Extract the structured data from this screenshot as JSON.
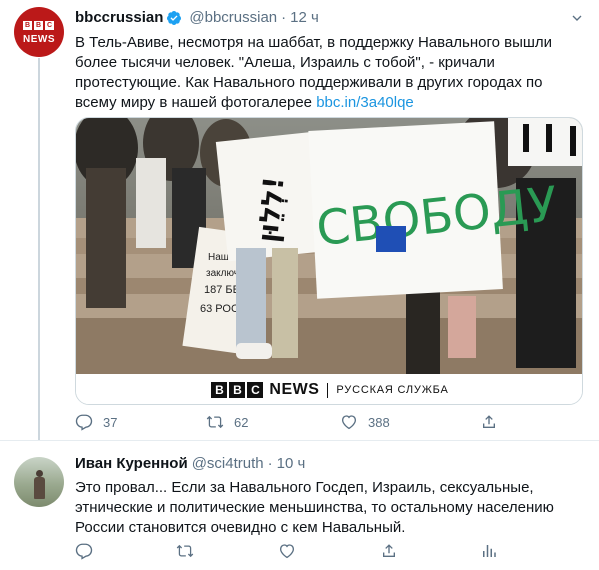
{
  "tweets": [
    {
      "author": {
        "name": "bbccrussian",
        "handle": "@bbcrussian",
        "verified": true,
        "time": "12 ч"
      },
      "avatar": {
        "blocks": [
          "B",
          "B",
          "C"
        ],
        "label": "NEWS"
      },
      "text": "В Тель-Авиве, несмотря на шаббат, в поддержку Навального вышли более тысячи человек. \"Алеша, Израиль с тобой\", - кричали протестующие. Как Навального поддерживали в других городах по всему миру в нашей фотогалерее ",
      "link": "bbc.in/3a40lqe",
      "media": {
        "caption_blocks": [
          "B",
          "B",
          "C"
        ],
        "caption_news": "NEWS",
        "caption_service": "РУССКАЯ СЛУЖБА",
        "sign_text": "СВОБОДУ",
        "left_sign_text": "לְלֵוּן!",
        "small_sign_lines": [
          "Наши",
          "заключе",
          "187 БЕЛ",
          "63 РОСС"
        ]
      },
      "actions": {
        "replies": "37",
        "retweets": "62",
        "likes": "388"
      }
    },
    {
      "author": {
        "name": "Иван Куренной",
        "handle": "@sci4truth",
        "time": "10 ч"
      },
      "text": "Это провал... Если за Навального Госдеп, Израиль, сексуальные, этнические и политические меньшинства, то остальному населению России становится очевидно с кем Навальный.",
      "actions": {
        "replies": "",
        "retweets": "",
        "likes": ""
      }
    }
  ],
  "colors": {
    "link": "#1b95e0",
    "muted": "#5b7083",
    "verified": "#1da1f2",
    "bbc_red": "#bb1919"
  }
}
